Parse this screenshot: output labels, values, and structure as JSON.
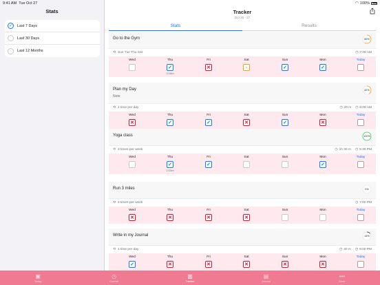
{
  "status_bar": {
    "time": "9:41 AM",
    "date": "Tue Oct 27",
    "battery": "100%"
  },
  "sidebar": {
    "title": "Stats",
    "periods": [
      {
        "label": "Last 7 Days",
        "selected": true
      },
      {
        "label": "Last 30 Days",
        "selected": false
      },
      {
        "label": "Last 12 Months",
        "selected": false
      }
    ]
  },
  "header": {
    "title": "Tracker",
    "subtitle": "Oct 20 - 27"
  },
  "tabs": [
    {
      "label": "Stats",
      "active": true
    },
    {
      "label": "Results",
      "active": false
    }
  ],
  "day_labels": [
    "Wed",
    "Thu",
    "Fri",
    "Sat",
    "Sun",
    "Mon",
    "Today"
  ],
  "habits": [
    {
      "name": "Go to the Gym",
      "note": "",
      "progress": "60%",
      "progress_value": 0.6,
      "progress_color": "#f7a11a",
      "frequency": "Sun Tue Thu Sat",
      "duration": "",
      "time": "7:00 AM",
      "states": [
        "empty",
        "check",
        "cross",
        "skip",
        "check",
        "check",
        "empty"
      ],
      "durations": [
        "",
        "0:16m",
        "",
        "",
        "",
        "",
        ""
      ]
    },
    {
      "name": "Plan my Day",
      "note": "Note",
      "progress": "42%",
      "progress_value": 0.42,
      "progress_color": "#f7a11a",
      "frequency": "1 time per day",
      "duration": "20 m",
      "time": "6:00 AM",
      "states": [
        "cross",
        "check",
        "check",
        "cross",
        "check",
        "cross",
        "empty"
      ],
      "durations": [
        "",
        "",
        "",
        "",
        "",
        "",
        ""
      ]
    },
    {
      "name": "Yoga class",
      "note": "",
      "progress": "100%",
      "progress_value": 1.0,
      "progress_color": "#34c759",
      "frequency": "3 times per week",
      "duration": "1h 30 m",
      "time": "5:30 PM",
      "states": [
        "empty",
        "check",
        "check",
        "empty",
        "empty",
        "check",
        "empty"
      ],
      "durations": [
        "",
        "1:15m",
        "",
        "",
        "",
        "",
        ""
      ]
    },
    {
      "name": "Run 3 miles",
      "note": "",
      "progress": "0%",
      "progress_value": 0.0,
      "progress_color": "#c7c7cc",
      "frequency": "4 times per week",
      "duration": "",
      "time": "7:00 PM",
      "states": [
        "cross",
        "cross",
        "cross",
        "cross",
        "empty",
        "empty",
        "empty"
      ],
      "durations": [
        "",
        "",
        "",
        "",
        "",
        "",
        ""
      ]
    },
    {
      "name": "Write in my Journal",
      "note": "",
      "progress": "14%",
      "progress_value": 0.14,
      "progress_color": "#1c1c1e",
      "frequency": "1 time per day",
      "duration": "40 m",
      "time": "8:00 PM",
      "states": [
        "check",
        "cross",
        "cross",
        "cross",
        "cross",
        "cross",
        "empty"
      ],
      "durations": [
        "",
        "",
        "",
        "",
        "",
        "",
        ""
      ]
    }
  ],
  "tabbar": [
    {
      "label": "Today",
      "icon": "calendar-icon",
      "active": false
    },
    {
      "label": "Overall",
      "icon": "clock-icon",
      "active": false
    },
    {
      "label": "Tracker",
      "icon": "bar-chart-icon",
      "active": true
    },
    {
      "label": "Journal",
      "icon": "book-icon",
      "active": false
    },
    {
      "label": "More",
      "icon": "more-icon",
      "active": false
    }
  ]
}
